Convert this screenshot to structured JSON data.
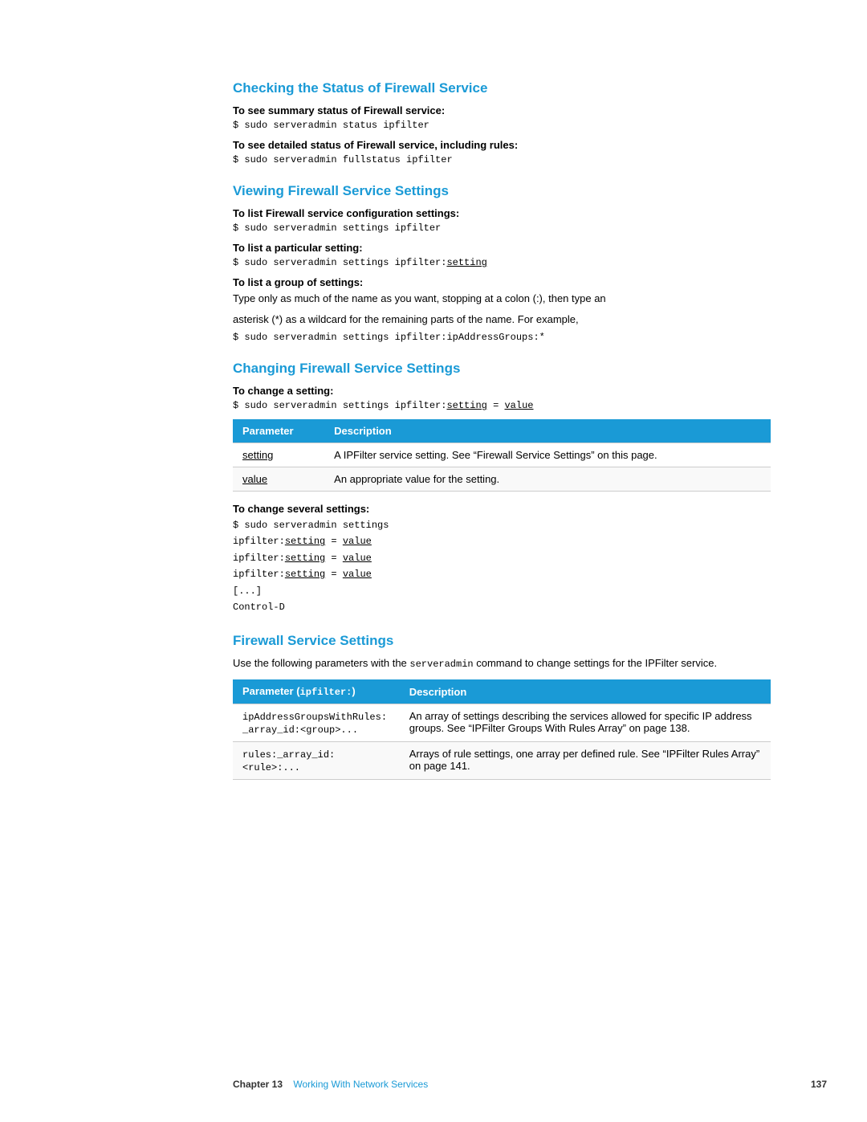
{
  "sections": {
    "checking": {
      "title": "Checking the Status of Firewall Service",
      "sub1_label": "To see summary status of Firewall service:",
      "sub1_code": "$ sudo serveradmin status ipfilter",
      "sub2_label": "To see detailed status of Firewall service, including rules:",
      "sub2_code": "$ sudo serveradmin fullstatus ipfilter"
    },
    "viewing": {
      "title": "Viewing Firewall Service Settings",
      "sub1_label": "To list Firewall service configuration settings:",
      "sub1_code": "$ sudo serveradmin settings ipfilter",
      "sub2_label": "To list a particular setting:",
      "sub2_code": "$ sudo serveradmin settings ipfilter:",
      "sub2_code_link": "setting",
      "sub3_label": "To list a group of settings:",
      "sub3_body1": "Type only as much of the name as you want, stopping at a colon (:), then type an",
      "sub3_body2": "asterisk (*) as a wildcard for the remaining parts of the name. For example,",
      "sub3_code": "$ sudo serveradmin settings ipfilter:ipAddressGroups:*"
    },
    "changing": {
      "title": "Changing Firewall Service Settings",
      "sub1_label": "To change a setting:",
      "sub1_code_prefix": "$ sudo serveradmin settings ipfilter:",
      "sub1_code_setting": "setting",
      "sub1_code_eq": " = ",
      "sub1_code_value": "value",
      "table1": {
        "headers": [
          "Parameter",
          "Description"
        ],
        "rows": [
          {
            "param": "setting",
            "desc": "A IPFilter service setting. See “Firewall Service Settings” on this page."
          },
          {
            "param": "value",
            "desc": "An appropriate value for the setting."
          }
        ]
      },
      "sub2_label": "To change several settings:",
      "sub2_code_lines": [
        "$ sudo serveradmin settings",
        "ipfilter:setting = value",
        "ipfilter:setting = value",
        "ipfilter:setting = value",
        "[...]",
        "Control-D"
      ]
    },
    "firewall": {
      "title": "Firewall Service Settings",
      "body_prefix": "Use the following parameters with the ",
      "body_inline_code": "serveradmin",
      "body_suffix": " command to change settings for the IPFilter service.",
      "table2": {
        "headers": [
          "Parameter (ipfilter:)",
          "Description"
        ],
        "rows": [
          {
            "param": "ipAddressGroupsWithRules:\n_array_id:<group>...",
            "desc": "An array of settings describing the services allowed for specific IP address groups. See “IPFilter Groups With Rules Array” on page 138."
          },
          {
            "param": "rules:_array_id:<rule>:...",
            "desc": "Arrays of rule settings, one array per defined rule. See “IPFilter Rules Array” on page 141."
          }
        ]
      }
    }
  },
  "footer": {
    "chapter_label": "Chapter 13",
    "chapter_text": "Working With Network Services",
    "page_number": "137"
  }
}
